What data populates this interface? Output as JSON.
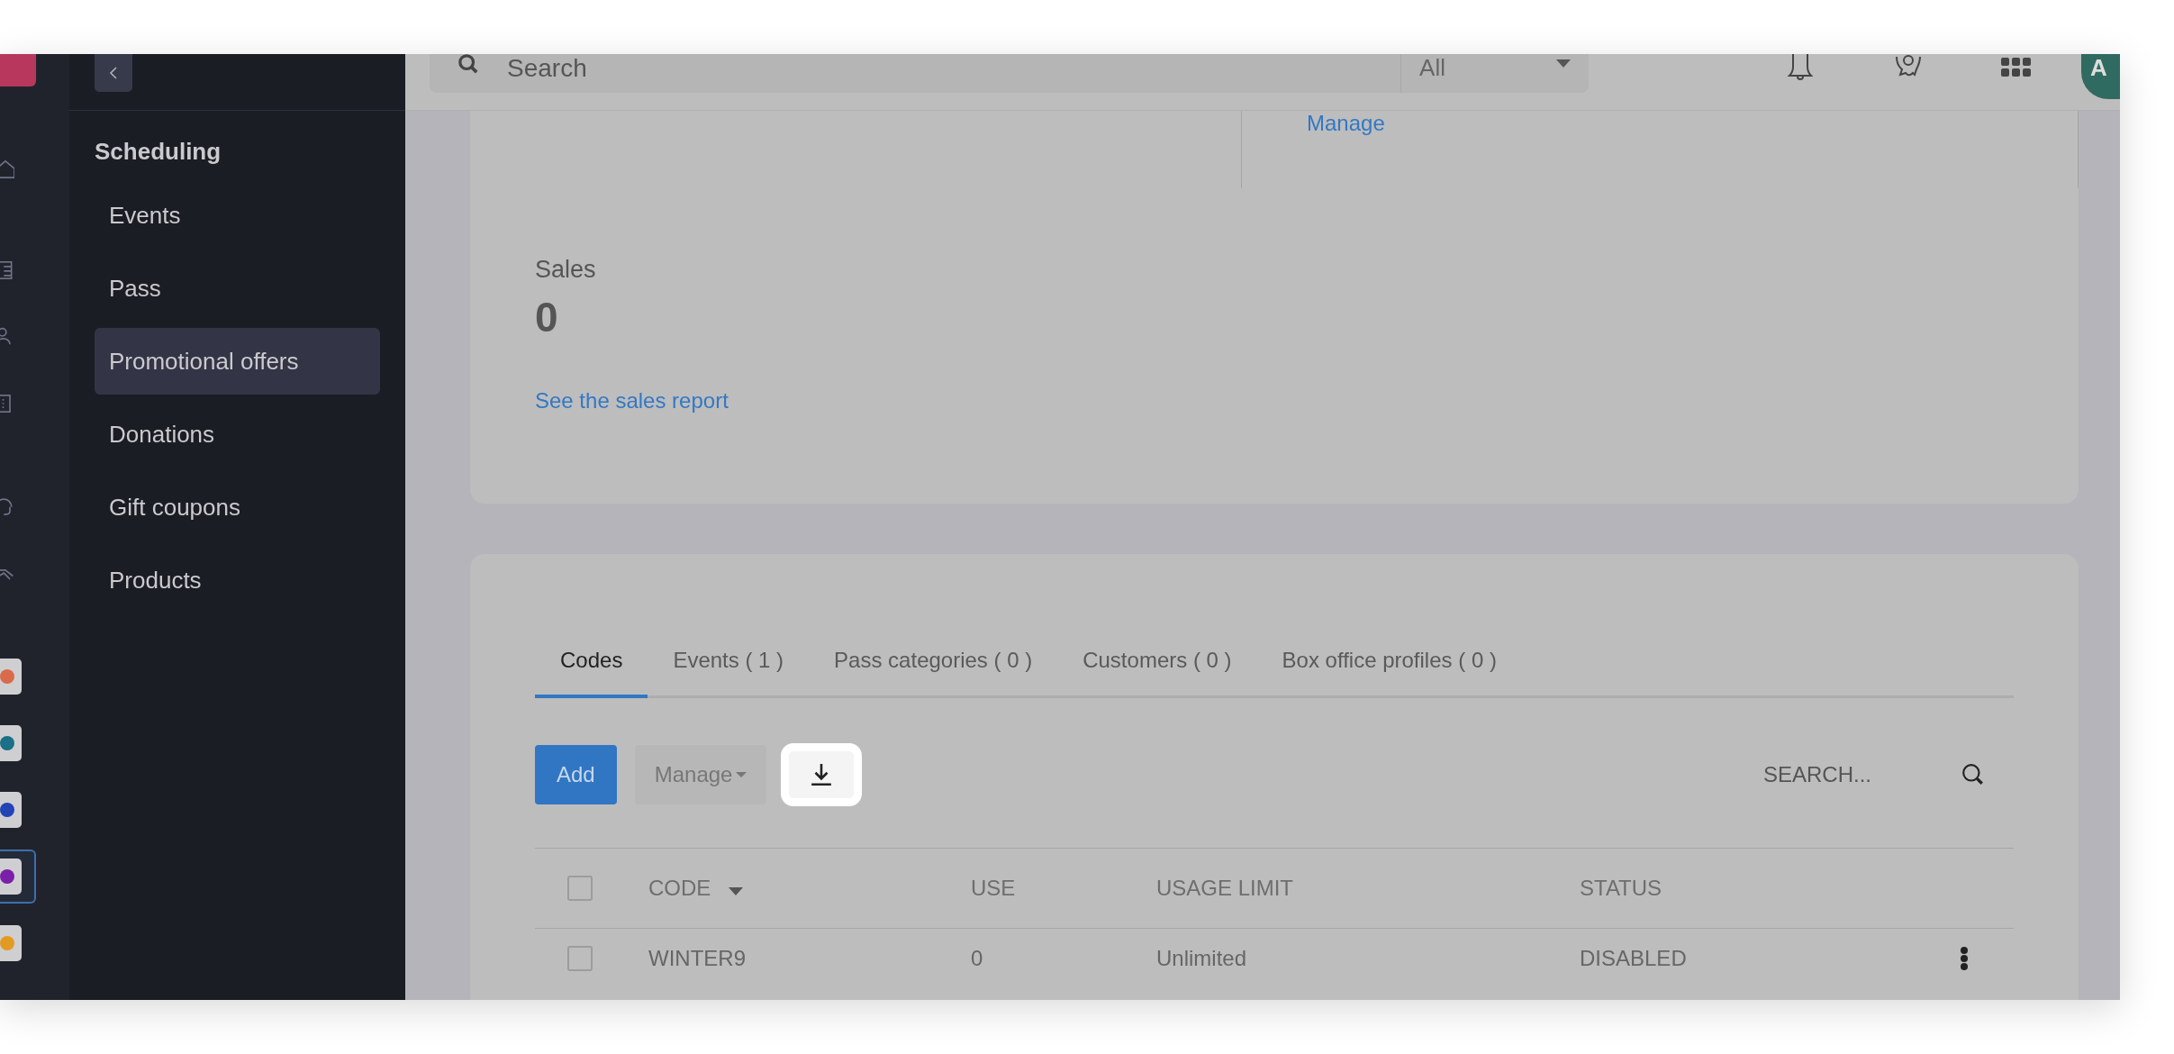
{
  "rail": {
    "apps": [
      {
        "selected": false
      },
      {
        "selected": false
      },
      {
        "selected": false
      },
      {
        "selected": true
      },
      {
        "selected": false
      }
    ]
  },
  "sidebar": {
    "section_title": "Scheduling",
    "items": [
      {
        "label": "Events",
        "selected": false
      },
      {
        "label": "Pass",
        "selected": false
      },
      {
        "label": "Promotional offers",
        "selected": true
      },
      {
        "label": "Donations",
        "selected": false
      },
      {
        "label": "Gift coupons",
        "selected": false
      },
      {
        "label": "Products",
        "selected": false
      }
    ]
  },
  "header": {
    "search_placeholder": "Search",
    "scope": "All",
    "avatar_initial": "A"
  },
  "summary": {
    "manage_link": "Manage",
    "sales_label": "Sales",
    "sales_value": "0",
    "report_link": "See the sales report"
  },
  "tabs": [
    {
      "label": "Codes",
      "selected": true
    },
    {
      "label": "Events ( 1 )",
      "selected": false
    },
    {
      "label": "Pass categories ( 0 )",
      "selected": false
    },
    {
      "label": "Customers ( 0 )",
      "selected": false
    },
    {
      "label": "Box office profiles ( 0 )",
      "selected": false
    }
  ],
  "toolbar": {
    "add": "Add",
    "manage": "Manage",
    "search_placeholder": "SEARCH..."
  },
  "table": {
    "all_checked": false,
    "columns": [
      "CODE",
      "USE",
      "USAGE LIMIT",
      "STATUS"
    ],
    "rows": [
      {
        "checked": false,
        "cells": [
          "WINTER9",
          "0",
          "Unlimited",
          "DISABLED"
        ]
      }
    ]
  }
}
